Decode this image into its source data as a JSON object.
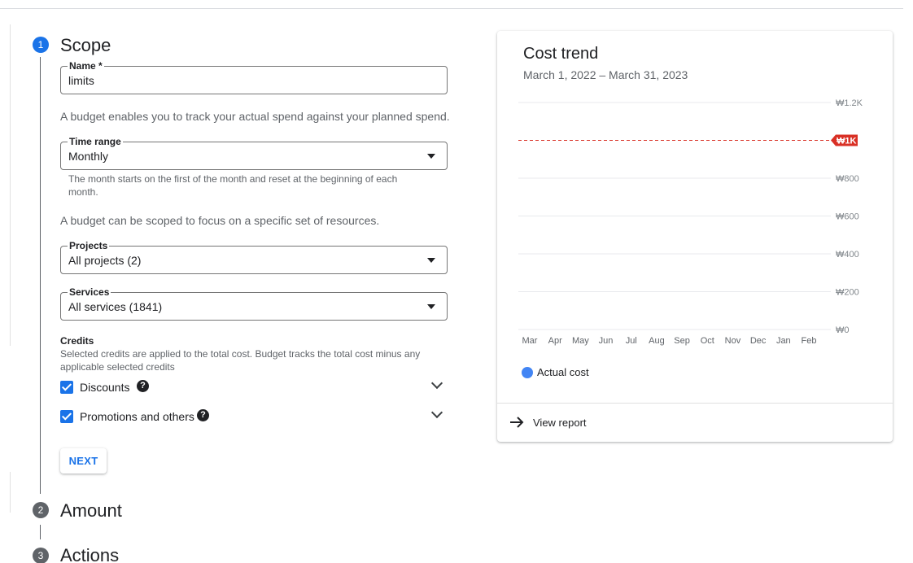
{
  "steps": [
    {
      "number": "1",
      "title": "Scope"
    },
    {
      "number": "2",
      "title": "Amount"
    },
    {
      "number": "3",
      "title": "Actions"
    }
  ],
  "scope": {
    "name_field": {
      "label": "Name *",
      "value": "limits"
    },
    "budget_info": "A budget enables you to track your actual spend against your planned spend.",
    "time_range": {
      "label": "Time range",
      "value": "Monthly",
      "hint_line1": "The month starts on the first of the month and reset at the beginning of each",
      "hint_line2": "month."
    },
    "scope_info": "A budget can be scoped to focus on a specific set of resources.",
    "projects": {
      "label": "Projects",
      "value": "All projects (2)"
    },
    "services": {
      "label": "Services",
      "value": "All services (1841)"
    },
    "credits": {
      "title": "Credits",
      "desc_line1": "Selected credits are applied to the total cost. Budget tracks the total cost minus any",
      "desc_line2": "applicable selected credits",
      "items": [
        {
          "label": "Discounts",
          "checked": true
        },
        {
          "label": "Promotions and others",
          "checked": true
        }
      ]
    },
    "next_label": "NEXT"
  },
  "cost_trend": {
    "title": "Cost trend",
    "date_range": "March 1, 2022 – March 31, 2023",
    "legend_label": "Actual cost",
    "view_report_label": "View report",
    "budget_color": "#d93025",
    "series_color": "#4285f4"
  },
  "chart_data": {
    "type": "line",
    "categories": [
      "Mar",
      "Apr",
      "May",
      "Jun",
      "Jul",
      "Aug",
      "Sep",
      "Oct",
      "Nov",
      "Dec",
      "Jan",
      "Feb"
    ],
    "y_ticks": [
      "₩0",
      "₩200",
      "₩400",
      "₩600",
      "₩800",
      "₩1K",
      "₩1.2K"
    ],
    "ylim": [
      0,
      1200
    ],
    "budget_line": {
      "value": 1000,
      "label": "₩1K"
    },
    "series": [
      {
        "name": "Actual cost",
        "values": []
      }
    ],
    "grid": true,
    "legend_position": "bottom-left"
  }
}
